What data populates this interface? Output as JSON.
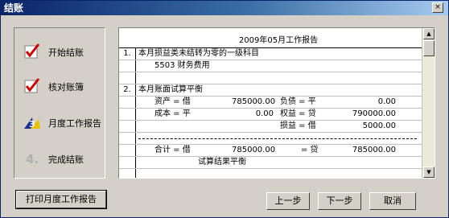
{
  "window": {
    "title": "结账",
    "close_glyph": "×"
  },
  "steps": [
    {
      "label": "开始结账",
      "icon": "checkmark-icon"
    },
    {
      "label": "核对账簿",
      "icon": "checkmark-icon"
    },
    {
      "label": "月度工作报告",
      "icon": "step-3-icon"
    },
    {
      "label": "完成结账",
      "icon": "step-4-icon"
    }
  ],
  "report": {
    "title": "2009年05月工作报告",
    "section1": {
      "num": "1.",
      "heading": "本月损益类未结转为零的一级科目",
      "account": "5503 财务费用"
    },
    "section2": {
      "num": "2.",
      "heading": "本月账面试算平衡",
      "lines": [
        {
          "a": "资产 = 借",
          "b": "785000.00",
          "c": "负债 = 平",
          "d": "0.00"
        },
        {
          "a": "成本 = 平",
          "b": "0.00",
          "c": "权益 = 贷",
          "d": "790000.00"
        },
        {
          "a": "",
          "b": "",
          "c": "损益 = 借",
          "d": "5000.00"
        }
      ],
      "total": {
        "a": "合计 = 借",
        "b": "785000.00",
        "c": "= 贷",
        "d": "785000.00"
      },
      "result": "试算结果平衡"
    }
  },
  "buttons": {
    "print": "打印月度工作报告",
    "prev": "上一步",
    "next": "下一步",
    "cancel": "取消"
  }
}
